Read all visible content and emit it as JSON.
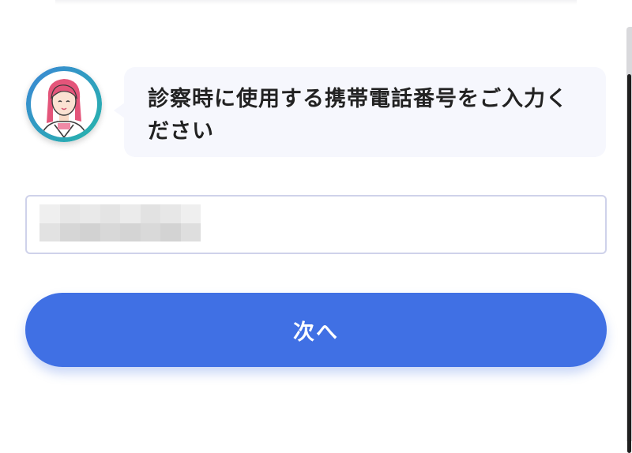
{
  "prompt": {
    "line1": "診察時に使用する携帯電話番号をご入力く",
    "line2": "ださい"
  },
  "avatar": {
    "icon": "nurse-avatar-icon",
    "ring_colors": [
      "#3a8fd3",
      "#2cb3b0"
    ]
  },
  "phone_field": {
    "value_masked": true
  },
  "next_button": {
    "label": "次へ",
    "color": "#4070e4"
  }
}
